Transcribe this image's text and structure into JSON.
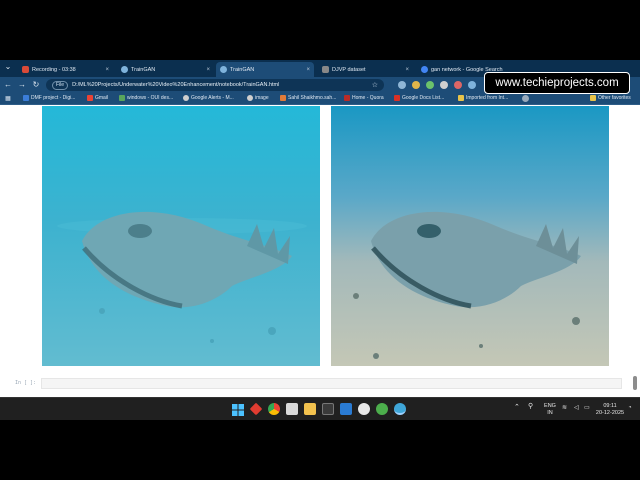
{
  "browser": {
    "tabs": [
      {
        "label": "Recording - 03:38",
        "active": false
      },
      {
        "label": "TrainGAN",
        "active": false
      },
      {
        "label": "TrainGAN",
        "active": true
      },
      {
        "label": "DJVP dataset",
        "active": false
      },
      {
        "label": "gan network - Google Search",
        "active": false
      }
    ],
    "address": {
      "info": "File",
      "url": "D:/ML%20Projects/Underwater%20Video%20Enhancement/notebook/TrainGAN.html"
    },
    "bookmarks": [
      "DMF project - Digi...",
      "Gmail",
      "windows - OUI des...",
      "Google Alerts - M...",
      "image",
      "Sahil Shaikhmo.sah...",
      "Home - Quora",
      "Google Docs List...",
      "Imported from Int...",
      "Other favorites"
    ]
  },
  "watermark": "www.techieprojects.com",
  "notebook": {
    "cell_prompt": "In [ ]:"
  },
  "taskbar": {
    "lang_top": "ENG",
    "lang_bottom": "IN",
    "time": "09:11",
    "date": "20-12-2025"
  },
  "colors": {
    "tab_strip": "#0b2f4f",
    "toolbar": "#1d4c77",
    "left_image_water": "#2fb2cf",
    "right_image_water": "#5aa8c8",
    "taskbar": "#202020"
  },
  "icons": [
    "back-arrow-icon",
    "forward-arrow-icon",
    "reload-icon",
    "star-icon",
    "windows-icon",
    "chrome-icon",
    "folder-icon",
    "vscode-icon",
    "notification-icon"
  ]
}
